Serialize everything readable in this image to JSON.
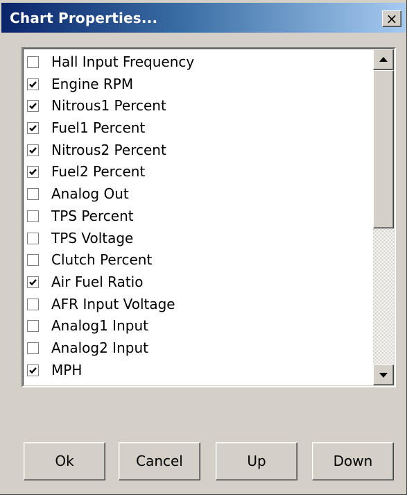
{
  "window": {
    "title": "Chart Properties...",
    "close_glyph": "×",
    "colors": {
      "titlebar_start": "#0a246a",
      "titlebar_end": "#a6caf0",
      "face": "#d4d0c8"
    }
  },
  "list": {
    "items": [
      {
        "label": "Hall Input Frequency",
        "checked": false
      },
      {
        "label": "Engine RPM",
        "checked": true
      },
      {
        "label": "Nitrous1 Percent",
        "checked": true
      },
      {
        "label": "Fuel1 Percent",
        "checked": true
      },
      {
        "label": "Nitrous2 Percent",
        "checked": true
      },
      {
        "label": "Fuel2 Percent",
        "checked": true
      },
      {
        "label": "Analog Out",
        "checked": false
      },
      {
        "label": "TPS Percent",
        "checked": false
      },
      {
        "label": "TPS Voltage",
        "checked": false
      },
      {
        "label": "Clutch Percent",
        "checked": false
      },
      {
        "label": "Air Fuel Ratio",
        "checked": true
      },
      {
        "label": "AFR Input Voltage",
        "checked": false
      },
      {
        "label": "Analog1 Input",
        "checked": false
      },
      {
        "label": "Analog2 Input",
        "checked": false
      },
      {
        "label": "MPH",
        "checked": true
      }
    ],
    "scroll_position": 0
  },
  "buttons": {
    "ok": "Ok",
    "cancel": "Cancel",
    "up": "Up",
    "down": "Down"
  }
}
